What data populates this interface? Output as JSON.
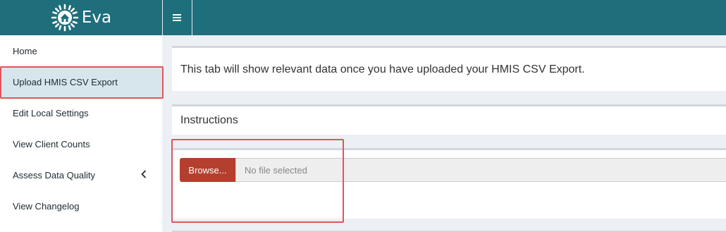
{
  "app": {
    "name": "Eva"
  },
  "colors": {
    "header": "#1e6e7b",
    "active_item": "#d6e6ec",
    "browse_button": "#b53f2e",
    "highlight": "#e2545a"
  },
  "icons": {
    "menu_toggle": "hamburger-icon",
    "logo": "sun-house-logo",
    "expand": "chevron-left-icon"
  },
  "sidebar": {
    "items": [
      {
        "label": "Home"
      },
      {
        "label": "Upload HMIS CSV Export"
      },
      {
        "label": "Edit Local Settings"
      },
      {
        "label": "View Client Counts"
      },
      {
        "label": "Assess Data Quality"
      },
      {
        "label": "View Changelog"
      }
    ]
  },
  "main": {
    "notice": "This tab will show relevant data once you have uploaded your HMIS CSV Export.",
    "instructions_title": "Instructions",
    "upload": {
      "browse_label": "Browse...",
      "file_status": "No file selected"
    }
  }
}
